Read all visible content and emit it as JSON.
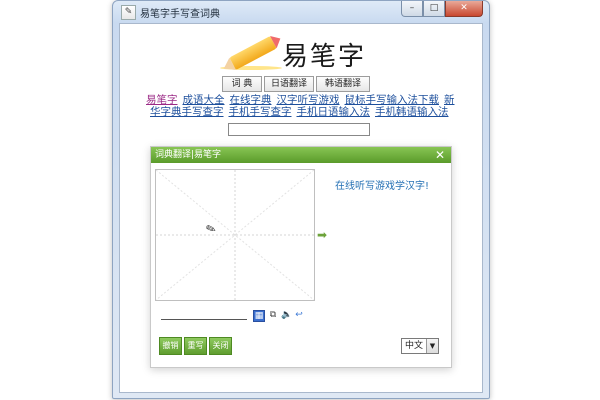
{
  "window": {
    "title": "易笔字手写查词典",
    "app_icon_glyph": "✎",
    "minimize_glyph": "–",
    "maximize_glyph": "□",
    "close_glyph": "✕"
  },
  "logo": {
    "text": "易笔字"
  },
  "tabs": [
    {
      "label": "词 典"
    },
    {
      "label": "日语翻译"
    },
    {
      "label": "韩语翻译"
    }
  ],
  "links": {
    "line1": [
      "易笔字",
      "成语大全",
      "在线字典",
      "汉字听写游戏",
      "鼠标手写输入法下载",
      "新"
    ],
    "line2": [
      "华字典手写查字",
      "手机手写查字",
      "手机日语输入法",
      "手机韩语输入法"
    ]
  },
  "search": {
    "value": ""
  },
  "dialog": {
    "title": "词典翻译|易笔字",
    "close_glyph": "✕",
    "promo_text": "在线听写游戏学汉字!",
    "arrow_glyph": "➡",
    "cursor_glyph": "✎",
    "tool_icons": {
      "keyboard": "▦",
      "copy": "⧉",
      "speaker": "🔈",
      "back": "↩"
    },
    "buttons": {
      "undo": "撤销",
      "rewrite": "重写",
      "close": "关闭"
    },
    "language": {
      "selected": "中文",
      "chevron": "▼"
    }
  }
}
